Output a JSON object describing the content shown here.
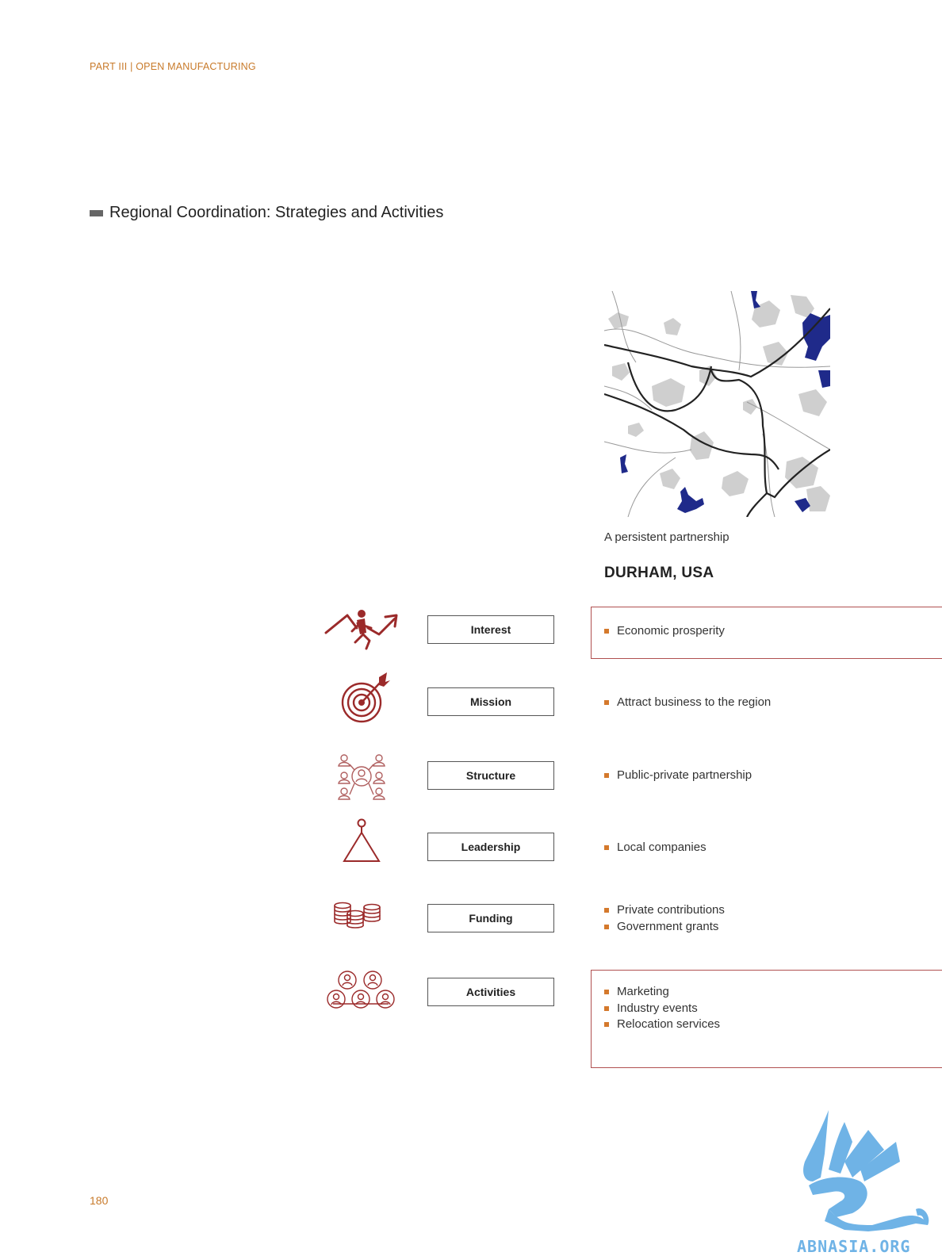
{
  "header": {
    "part_label": "PART III | OPEN MANUFACTURING"
  },
  "section": {
    "title": "Regional Coordination: Strategies and Activities"
  },
  "case": {
    "caption": "A persistent partnership",
    "city": "DURHAM, USA",
    "map_water_color": "#1f2a8a",
    "map_urban_color": "#c8c8c8"
  },
  "rows": [
    {
      "icon": "rising-graph-person-icon",
      "label": "Interest",
      "items": [
        "Economic prosperity"
      ]
    },
    {
      "icon": "target-arrow-icon",
      "label": "Mission",
      "items": [
        "Attract business to the region"
      ]
    },
    {
      "icon": "network-people-icon",
      "label": "Structure",
      "items": [
        "Public-private partnership"
      ]
    },
    {
      "icon": "pin-triangle-icon",
      "label": "Leadership",
      "items": [
        "Local companies"
      ]
    },
    {
      "icon": "coin-stacks-icon",
      "label": "Funding",
      "items": [
        "Private contributions",
        "Government grants"
      ]
    },
    {
      "icon": "people-group-icon",
      "label": "Activities",
      "items": [
        "Marketing",
        "Industry events",
        "Relocation services"
      ]
    }
  ],
  "footer": {
    "page_number": "180",
    "watermark_text": "ABNASIA.ORG"
  },
  "colors": {
    "accent": "#c87a2a",
    "icon_red": "#9b2a2a",
    "box_border": "#b05050"
  }
}
